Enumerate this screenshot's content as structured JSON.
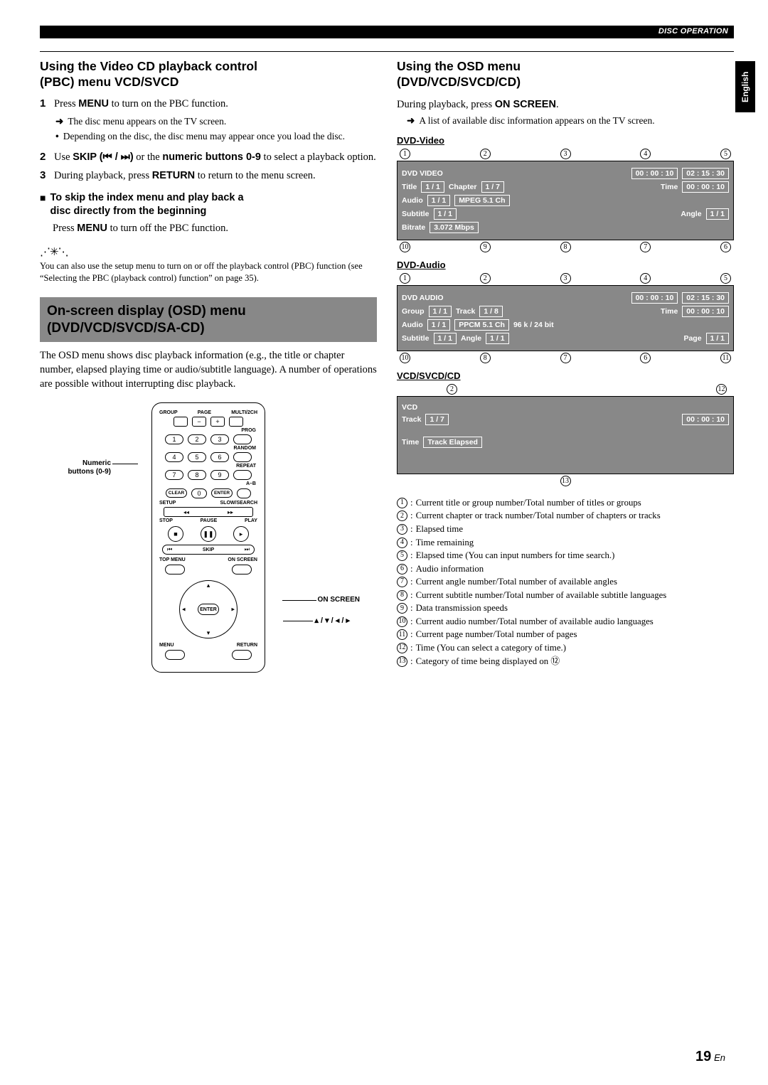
{
  "header": {
    "section_tag": "DISC OPERATION",
    "language": "English"
  },
  "left": {
    "h_pbc_1": "Using the Video CD playback control",
    "h_pbc_2": "PBC) menu VCD/SVCD",
    "step1_pre": "Press ",
    "step1_bold": "MENU",
    "step1_post": " to turn on the PBC function.",
    "step1_note_a": "The disc menu appears on the TV screen.",
    "step1_note_b": "Depending on the disc, the disc menu may appear once you load the disc.",
    "step2_pre": "Use ",
    "step2_bold1": "SKIP (",
    "step2_icons": "⏮ / ⏭",
    "step2_bold1b": ")",
    "step2_mid": " or the ",
    "step2_bold2": "numeric buttons 0-9",
    "step2_post": " to select a playback option.",
    "step3_pre": "During playback, press ",
    "step3_bold": "RETURN",
    "step3_post": " to return to the menu screen.",
    "skip_h1": "To skip the index menu and play back a",
    "skip_h2": "disc directly from the beginning",
    "skip_b_pre": "Press ",
    "skip_b_bold": "MENU",
    "skip_b_post": " to turn off the PBC function.",
    "hint": "You can also use the setup menu to turn on or off the playback control (PBC) function (see “Selecting the PBC (playback control) function” on page 35).",
    "osd_banner_1": "On-screen display (OSD) menu",
    "osd_banner_2": "DVD/VCD/SVCD/SA-CD)",
    "osd_para": "The OSD menu shows disc playback information (e.g., the title or chapter number, elapsed playing time or audio/subtitle language). A number of operations are possible without interrupting disc playback.",
    "callout_numeric_1": "Numeric",
    "callout_numeric_2": "buttons (0-9)",
    "callout_onscreen": "ON SCREEN",
    "callout_arrows": "▴ / ▾ / ◂ / ▸",
    "remote": {
      "top": {
        "group": "GROUP",
        "page": "PAGE",
        "multi": "MULTI/2CH",
        "minus": "−",
        "plus": "+"
      },
      "labels": {
        "prog": "PROG",
        "random": "RANDOM",
        "repeat": "REPEAT",
        "ab": "A–B",
        "setup": "SETUP",
        "slow": "SLOW/SEARCH",
        "stop": "STOP",
        "pause": "PAUSE",
        "play": "PLAY",
        "skip": "SKIP",
        "topmenu": "TOP MENU",
        "onscreen": "ON SCREEN",
        "menu": "MENU",
        "return": "RETURN",
        "enter": "ENTER",
        "clear": "CLEAR",
        "entersm": "ENTER"
      },
      "nums": [
        "1",
        "2",
        "3",
        "4",
        "5",
        "6",
        "7",
        "8",
        "9",
        "0"
      ]
    }
  },
  "right": {
    "h_osd_1": "Using the OSD menu",
    "h_osd_2": "DVD/VCD/SVCD/CD)",
    "intro_pre": "During playback, press ",
    "intro_bold": "ON SCREEN",
    "intro_post": ".",
    "intro_note": "A list of available disc information appears on the TV screen.",
    "subhead_dvdvideo": "DVD-Video",
    "subhead_dvdaudio": "DVD-Audio",
    "subhead_vcd": "VCD/SVCD/CD",
    "dvdvideo": {
      "markers_top": [
        "1",
        "2",
        "3",
        "4",
        "5"
      ],
      "type": "DVD VIDEO",
      "elapsed": "00 : 00 : 10",
      "remaining": "02 : 15 : 30",
      "title_l": "Title",
      "title_v": "1 / 1",
      "chapter_l": "Chapter",
      "chapter_v": "1 / 7",
      "time_l": "Time",
      "time_v": "00 : 00 : 10",
      "audio_l": "Audio",
      "audio_v": "1 / 1",
      "audio_fmt": "MPEG 5.1 Ch",
      "sub_l": "Subtitle",
      "sub_v": "1 / 1",
      "angle_l": "Angle",
      "angle_v": "1 / 1",
      "bitrate_l": "Bitrate",
      "bitrate_v": "3.072 Mbps",
      "markers_bot": [
        "10",
        "9",
        "8",
        "7",
        "6"
      ]
    },
    "dvdaudio": {
      "markers_top": [
        "1",
        "2",
        "3",
        "4",
        "5"
      ],
      "type": "DVD AUDIO",
      "elapsed": "00 : 00 : 10",
      "remaining": "02 : 15 : 30",
      "group_l": "Group",
      "group_v": "1 / 1",
      "track_l": "Track",
      "track_v": "1 / 8",
      "time_l": "Time",
      "time_v": "00 : 00 : 10",
      "audio_l": "Audio",
      "audio_v": "1 / 1",
      "audio_fmt": "PPCM 5.1 Ch",
      "audio_rate": "96 k / 24 bit",
      "sub_l": "Subtitle",
      "sub_v": "1 / 1",
      "angle_l": "Angle",
      "angle_v": "1 / 1",
      "page_l": "Page",
      "page_v": "1 / 1",
      "markers_bot": [
        "10",
        "8",
        "7",
        "6",
        "11"
      ]
    },
    "vcd": {
      "markers_top": [
        "2",
        "12"
      ],
      "type": "VCD",
      "track_l": "Track",
      "track_v": "1 / 7",
      "time_v": "00 : 00 : 10",
      "time_l": "Time",
      "mode": "Track Elapsed",
      "markers_bot": [
        "13"
      ]
    },
    "legend": [
      {
        "n": "1",
        "t": "Current title or group number/Total number of titles or groups"
      },
      {
        "n": "2",
        "t": "Current chapter or track number/Total number of chapters or tracks"
      },
      {
        "n": "3",
        "t": "Elapsed time"
      },
      {
        "n": "4",
        "t": "Time remaining"
      },
      {
        "n": "5",
        "t": "Elapsed time (You can input numbers for time search.)"
      },
      {
        "n": "6",
        "t": "Audio information"
      },
      {
        "n": "7",
        "t": "Current angle number/Total number of available angles"
      },
      {
        "n": "8",
        "t": "Current subtitle number/Total number of available subtitle languages"
      },
      {
        "n": "9",
        "t": "Data transmission speeds"
      },
      {
        "n": "10",
        "t": "Current audio number/Total number of available audio languages"
      },
      {
        "n": "11",
        "t": "Current page number/Total number of pages"
      },
      {
        "n": "12",
        "t": "Time (You can select a category of time.)"
      },
      {
        "n": "13",
        "t": "Category of time being displayed on ⑫"
      }
    ]
  },
  "page": {
    "num": "19",
    "suffix": "En"
  }
}
